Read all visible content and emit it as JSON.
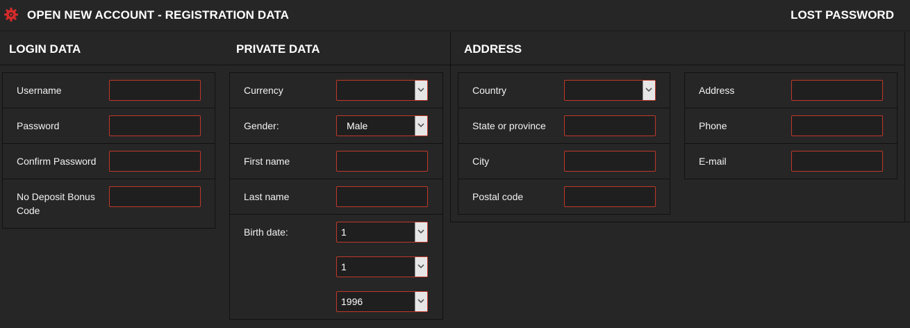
{
  "header": {
    "title": "OPEN NEW ACCOUNT - REGISTRATION DATA",
    "lost_password": "LOST PASSWORD"
  },
  "colors": {
    "background": "#262626",
    "accent": "#c0392b",
    "field_bg": "#1f1f1f"
  },
  "icons": {
    "header": "gear-icon",
    "select": "chevron-down-icon"
  },
  "login": {
    "title": "LOGIN DATA",
    "username_label": "Username",
    "username_value": "",
    "password_label": "Password",
    "password_value": "",
    "confirm_label": "Confirm Password",
    "confirm_value": "",
    "bonus_label_line1": "No Deposit Bonus",
    "bonus_label_line2": "Code",
    "bonus_value": ""
  },
  "private": {
    "title": "PRIVATE DATA",
    "currency_label": "Currency",
    "currency_value": "",
    "gender_label": "Gender:",
    "gender_value": "Male",
    "first_label": "First name",
    "first_value": "",
    "last_label": "Last name",
    "last_value": "",
    "birth_label": "Birth date:",
    "birth_day": "1",
    "birth_month": "1",
    "birth_year": "1996"
  },
  "address": {
    "title": "ADDRESS",
    "country_label": "Country",
    "country_value": "",
    "state_label": "State or province",
    "state_value": "",
    "city_label": "City",
    "city_value": "",
    "postal_label": "Postal code",
    "postal_value": "",
    "address_label": "Address",
    "address_value": "",
    "phone_label": "Phone",
    "phone_value": "",
    "email_label": "E-mail",
    "email_value": ""
  }
}
